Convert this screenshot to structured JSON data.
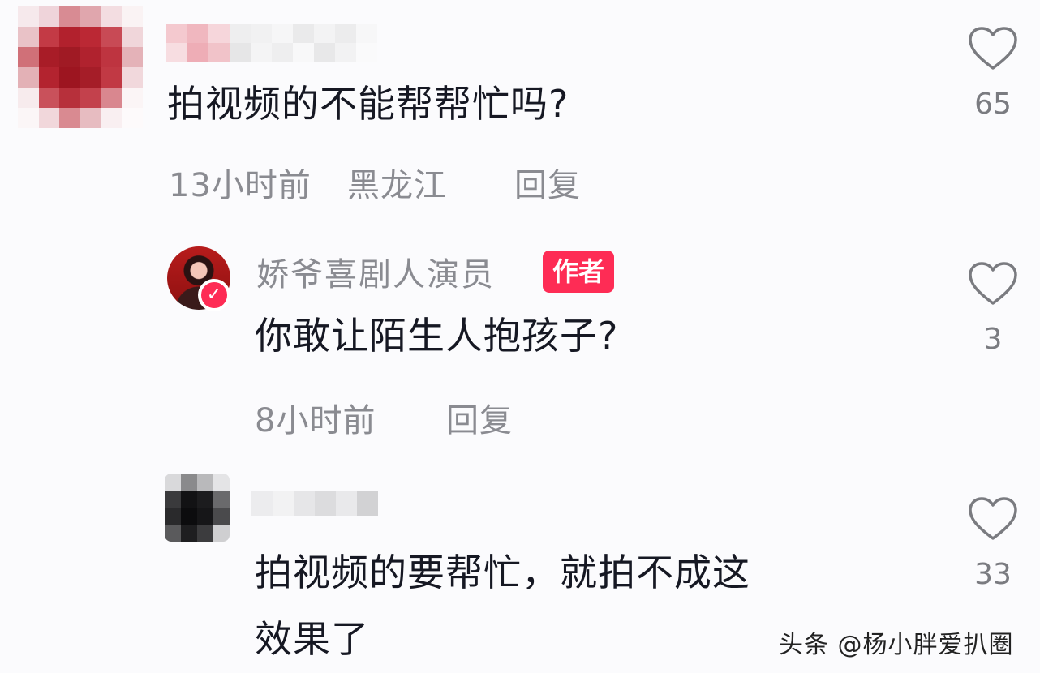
{
  "comments": [
    {
      "username": "",
      "text": "拍视频的不能帮帮忙吗?",
      "time": "13小时前",
      "location": "黑龙江",
      "reply_label": "回复",
      "likes": "65",
      "avatar_icon": "pixelated-avatar"
    },
    {
      "username": "娇爷喜剧人演员",
      "badge": "作者",
      "text": "你敢让陌生人抱孩子?",
      "time": "8小时前",
      "reply_label": "回复",
      "likes": "3",
      "avatar_icon": "author-avatar-verified",
      "accent_color": "#fe2c55"
    },
    {
      "username": "",
      "text_line1": "拍视频的要帮忙，就拍不成这",
      "text_line2": "效果了",
      "likes": "33",
      "avatar_icon": "pixelated-avatar"
    }
  ],
  "watermark": "头条 @杨小胖爱扒圈",
  "colors": {
    "primary_text": "#161823",
    "secondary_text": "#8a8b91",
    "accent": "#fe2c55",
    "background": "#fbfbfd"
  }
}
